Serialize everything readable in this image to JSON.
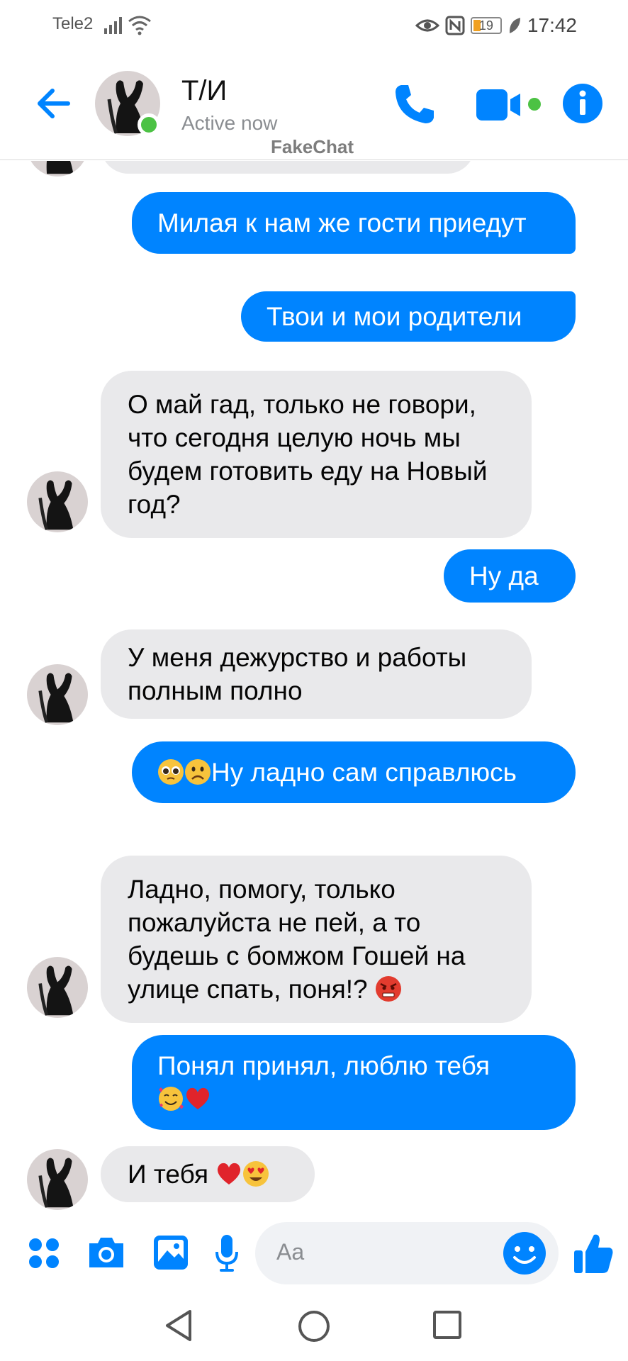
{
  "status_bar": {
    "carrier": "Tele2",
    "time": "17:42",
    "battery": "19"
  },
  "header": {
    "contact_name": "Т/И",
    "contact_status": "Active now",
    "watermark": "FakeChat"
  },
  "messages": [
    {
      "from": "me",
      "text": "Милая к нам же гости приедут"
    },
    {
      "from": "me",
      "text": "Твои и мои родители"
    },
    {
      "from": "them",
      "text": "О май гад, только не говори, что сегодня целую ночь мы будем готовить еду на Новый год?"
    },
    {
      "from": "me",
      "text": "Ну да"
    },
    {
      "from": "them",
      "text": "У меня дежурство и работы полным полно"
    },
    {
      "from": "me",
      "text": "Ну ладно сам справлюсь",
      "emojis_before": [
        "pleading-face",
        "frowning-face"
      ]
    },
    {
      "from": "them",
      "text": "Ладно, помогу, только пожалуйста не пей, а то будешь с бомжом Гошей на улице спать, поня!?",
      "emojis_after": [
        "angry-face"
      ]
    },
    {
      "from": "me",
      "text": "Понял принял, люблю тебя",
      "emojis_after": [
        "smiling-face-with-hearts",
        "red-heart"
      ]
    },
    {
      "from": "them",
      "text": "И тебя",
      "emojis_after": [
        "red-heart",
        "heart-eyes-face"
      ]
    }
  ],
  "composer": {
    "placeholder": "Aa"
  },
  "colors": {
    "accent": "#0084ff",
    "incoming_bubble": "#e9e9eb",
    "online": "#4cc244"
  }
}
